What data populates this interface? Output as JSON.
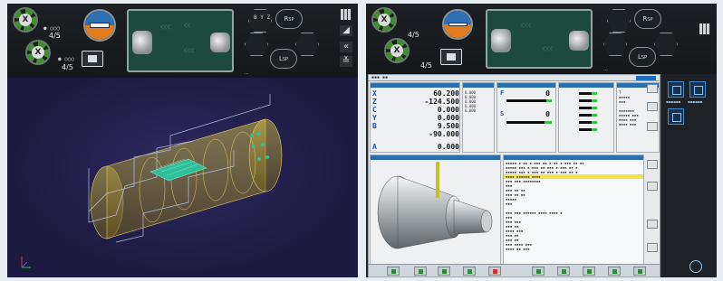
{
  "colors": {
    "accent_green": "#36c24a",
    "highlight_yellow": "#f3e244",
    "cnc_blue": "#2a6fae",
    "viewport_bg": "#1c1a40"
  },
  "left_header": {
    "wheel1_hub": "X",
    "wheel2_hub": "X",
    "fraction1": "4/5",
    "fraction2": "4/5",
    "rsp_label": "R",
    "lsp_label": "L",
    "rsp_sub": "SP",
    "lsp_sub": "SP",
    "status_text": "..."
  },
  "right_header": {
    "fraction1": "4/5",
    "fraction2": "4/5",
    "rsp_label": "R",
    "lsp_label": "L",
    "rsp_sub": "SP",
    "lsp_sub": "SP",
    "status_text": "..."
  },
  "cnc": {
    "axes": [
      {
        "axis": "X",
        "value": "60.200"
      },
      {
        "axis": "Z",
        "value": "-124.500"
      },
      {
        "axis": "C",
        "value": "0.000"
      },
      {
        "axis": "Y",
        "value": "0.000"
      },
      {
        "axis": "B",
        "value": "9.500"
      },
      {
        "axis": "",
        "value": "-90.000"
      },
      {
        "axis": "A",
        "value": "0.000"
      }
    ],
    "feed_label": "F",
    "spindle_label": "S",
    "feed_value": "0",
    "spindle_value": "0"
  },
  "side_panel": {
    "tile1_label": "",
    "tile2_label": ""
  }
}
